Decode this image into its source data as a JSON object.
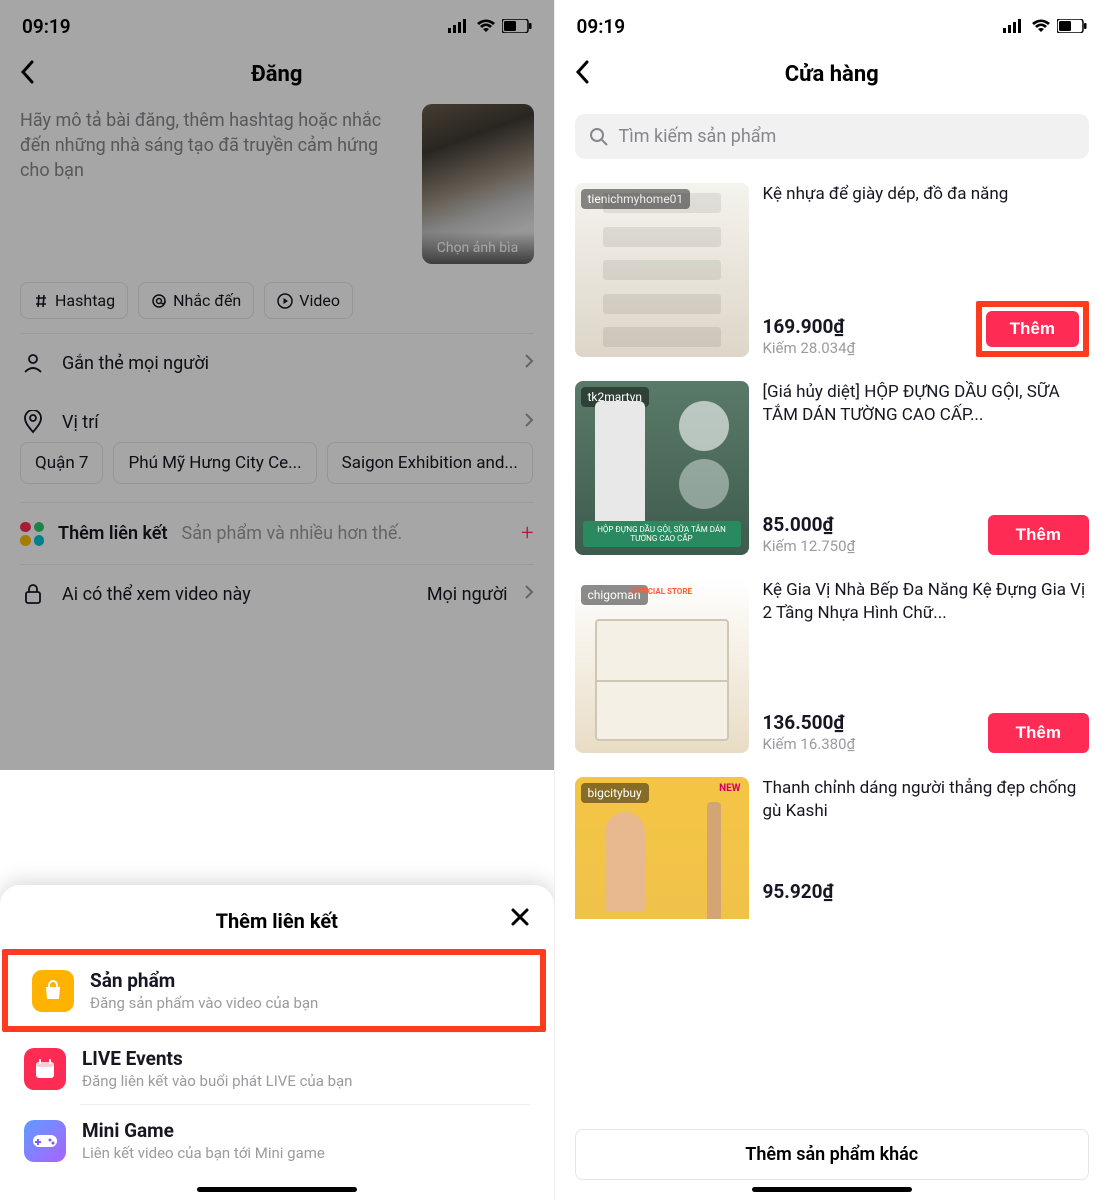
{
  "status": {
    "time": "09:19"
  },
  "left": {
    "title": "Đăng",
    "caption_placeholder": "Hãy mô tả bài đăng, thêm hashtag hoặc nhắc đến những nhà sáng tạo đã truyền cảm hứng cho bạn",
    "cover_label": "Chọn ảnh bìa",
    "chips": {
      "hashtag": "Hashtag",
      "mention": "Nhắc đến",
      "video": "Video"
    },
    "tag_people": "Gắn thẻ mọi người",
    "location_label": "Vị trí",
    "locations": [
      "Quận 7",
      "Phú Mỹ Hưng City Ce...",
      "Saigon Exhibition and..."
    ],
    "add_link_label": "Thêm liên kết",
    "add_link_hint": "Sản phẩm và nhiều hơn thế.",
    "privacy_label": "Ai có thể xem video này",
    "privacy_value": "Mọi người",
    "sheet": {
      "title": "Thêm liên kết",
      "items": [
        {
          "title": "Sản phẩm",
          "desc": "Đăng sản phẩm vào video của bạn"
        },
        {
          "title": "LIVE Events",
          "desc": "Đăng liên kết vào buổi phát LIVE của bạn"
        },
        {
          "title": "Mini Game",
          "desc": "Liên kết video của bạn tới Mini game"
        }
      ]
    }
  },
  "right": {
    "title": "Cửa hàng",
    "search_placeholder": "Tìm kiếm sản phẩm",
    "add_label": "Thêm",
    "more_products": "Thêm sản phẩm khác",
    "products": [
      {
        "seller": "tienichmyhome01",
        "title": "Kệ nhựa để giày dép, đồ đa năng",
        "price": "169.900₫",
        "earn": "Kiếm 28.034₫"
      },
      {
        "seller": "tk2martvn",
        "title": "[Giá hủy diệt] HỘP ĐỰNG DẦU GỘI, SỮA TẮM DÁN TƯỜNG CAO CẤP...",
        "price": "85.000₫",
        "earn": "Kiếm 12.750₫"
      },
      {
        "seller": "chigoman",
        "title": "Kệ Gia Vị Nhà Bếp Đa Năng Kệ Đựng Gia Vị 2 Tầng Nhựa Hình Chữ...",
        "price": "136.500₫",
        "earn": "Kiếm 16.380₫"
      },
      {
        "seller": "bigcitybuy",
        "title": "Thanh chỉnh dáng người thẳng đẹp chống gù Kashi",
        "price": "95.920₫",
        "earn": ""
      }
    ]
  }
}
